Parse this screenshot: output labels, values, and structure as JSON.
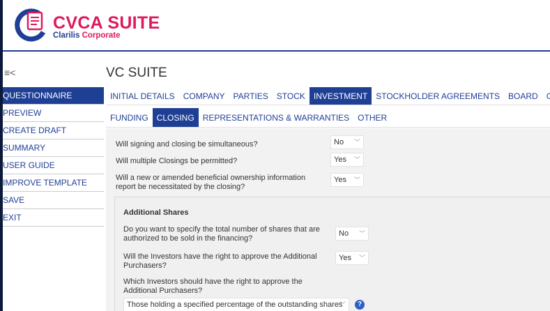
{
  "brand": {
    "title": "CVCA SUITE",
    "sub_part1": "Clarilis",
    "sub_part2": "Corporate"
  },
  "icons": {
    "menu": "≡<"
  },
  "page": {
    "title": "VC SUITE"
  },
  "sidebar": {
    "items": [
      {
        "label": "QUESTIONNAIRE",
        "active": true
      },
      {
        "label": "PREVIEW"
      },
      {
        "label": "CREATE DRAFT"
      },
      {
        "label": "SUMMARY"
      },
      {
        "label": "USER GUIDE"
      },
      {
        "label": "IMPROVE TEMPLATE"
      },
      {
        "label": "SAVE"
      },
      {
        "label": "EXIT"
      }
    ]
  },
  "tabs": [
    {
      "label": "INITIAL DETAILS"
    },
    {
      "label": "COMPANY"
    },
    {
      "label": "PARTIES"
    },
    {
      "label": "STOCK"
    },
    {
      "label": "INVESTMENT",
      "active": true
    },
    {
      "label": "STOCKHOLDER AGREEMENTS"
    },
    {
      "label": "BOARD"
    },
    {
      "label": "GENERAL"
    }
  ],
  "subtabs": [
    {
      "label": "FUNDING"
    },
    {
      "label": "CLOSING",
      "active": true
    },
    {
      "label": "REPRESENTATIONS & WARRANTIES"
    },
    {
      "label": "OTHER"
    }
  ],
  "questions": {
    "q1": {
      "text": "Will signing and closing be simultaneous?",
      "value": "No"
    },
    "q2": {
      "text": "Will multiple Closings be permitted?",
      "value": "Yes"
    },
    "q3": {
      "text": "Will a new or amended beneficial ownership information report be necessitated by the closing?",
      "value": "Yes"
    }
  },
  "additional_shares": {
    "title": "Additional Shares",
    "q1": {
      "text": "Do you want to specify the total number of shares that are authorized to be sold in the financing?",
      "value": "No"
    },
    "q2": {
      "text": "Will the Investors have the right to approve the Additional Purchasers?",
      "value": "Yes"
    },
    "q3": {
      "text": "Which Investors should have the right to approve the Additional Purchasers?",
      "value": "Those holding a specified percentage of the outstanding shares"
    }
  },
  "colors": {
    "brand_blue": "#1f3f95",
    "brand_pink": "#e0185d",
    "help_blue": "#2c61c6"
  }
}
